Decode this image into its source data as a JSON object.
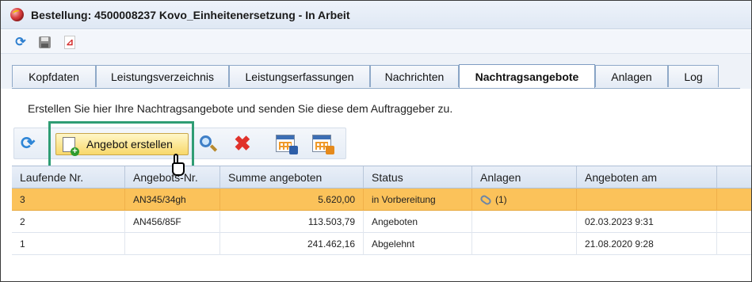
{
  "window": {
    "title": "Bestellung: 4500008237 Kovo_Einheitenersetzung - In Arbeit"
  },
  "top_toolbar": {
    "icons": [
      "refresh-icon",
      "save-icon",
      "pdf-icon"
    ]
  },
  "tabs": [
    {
      "label": "Kopfdaten",
      "active": false
    },
    {
      "label": "Leistungsverzeichnis",
      "active": false
    },
    {
      "label": "Leistungserfassungen",
      "active": false
    },
    {
      "label": "Nachrichten",
      "active": false
    },
    {
      "label": "Nachtragsangebote",
      "active": true
    },
    {
      "label": "Anlagen",
      "active": false
    },
    {
      "label": "Log",
      "active": false
    }
  ],
  "panel": {
    "info_text": "Erstellen Sie hier Ihre Nachtragsangebote und senden Sie diese dem Auftraggeber zu."
  },
  "action_toolbar": {
    "create_label": "Angebot erstellen",
    "icons": [
      "refresh-icon",
      "search-icon",
      "delete-icon",
      "export-icon",
      "import-icon"
    ]
  },
  "table": {
    "headers": [
      "Laufende Nr.",
      "Angebots-Nr.",
      "Summe angeboten",
      "Status",
      "Anlagen",
      "Angeboten am"
    ],
    "rows": [
      {
        "nr": "3",
        "angebot": "AN345/34gh",
        "summe": "5.620,00",
        "status": "in Vorbereitung",
        "anlagen": "(1)",
        "datum": "",
        "selected": true
      },
      {
        "nr": "2",
        "angebot": "AN456/85F",
        "summe": "113.503,79",
        "status": "Angeboten",
        "anlagen": "",
        "datum": "02.03.2023 9:31",
        "selected": false
      },
      {
        "nr": "1",
        "angebot": "",
        "summe": "241.462,16",
        "status": "Abgelehnt",
        "anlagen": "",
        "datum": "21.08.2020 9:28",
        "selected": false
      }
    ]
  },
  "colors": {
    "selected_row": "#fbc25a",
    "highlight_frame": "#2f9d74",
    "create_button": "#f8d86a"
  }
}
